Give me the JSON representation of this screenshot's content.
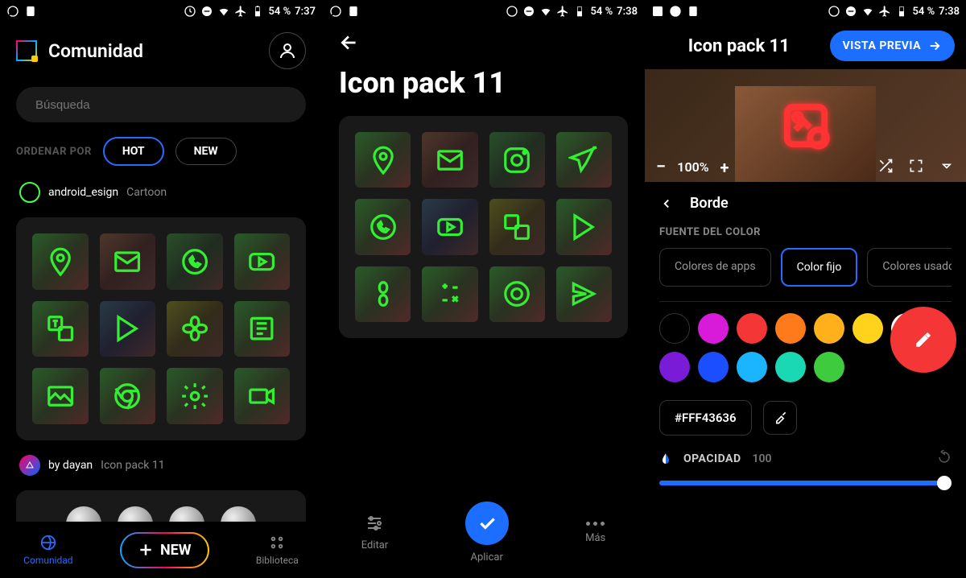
{
  "status": {
    "battery": "54 %",
    "time1": "7:37",
    "time2": "7:38",
    "time3": "7:38"
  },
  "p1": {
    "title": "Comunidad",
    "search_placeholder": "Búsqueda",
    "sort_label": "ORDENAR POR",
    "tabs": {
      "hot": "HOT",
      "new": "NEW"
    },
    "post1": {
      "author": "android_esign",
      "name": "Cartoon"
    },
    "post2": {
      "author": "by dayan",
      "name": "Icon pack 11"
    },
    "nav": {
      "comunidad": "Comunidad",
      "new": "NEW",
      "biblioteca": "Biblioteca"
    }
  },
  "p2": {
    "title": "Icon pack 11",
    "actions": {
      "editar": "Editar",
      "aplicar": "Aplicar",
      "mas": "Más"
    }
  },
  "p3": {
    "title": "Icon pack 11",
    "preview_btn": "VISTA PREVIA",
    "zoom": "100%",
    "section": "Borde",
    "source_label": "FUENTE DEL COLOR",
    "chips": {
      "apps": "Colores de apps",
      "fixed": "Color fijo",
      "used": "Colores usados"
    },
    "hex": "#FFF43636",
    "opacity_label": "OPACIDAD",
    "opacity_value": "100",
    "colors": [
      "#000000",
      "#d81bd8",
      "#f43636",
      "#ff7a1b",
      "#ffb01b",
      "#ffd21b",
      "#ffffff",
      "#7a1bd8",
      "#1b4eff",
      "#1bb4ff",
      "#1bd8b4",
      "#3ecc3e"
    ]
  }
}
